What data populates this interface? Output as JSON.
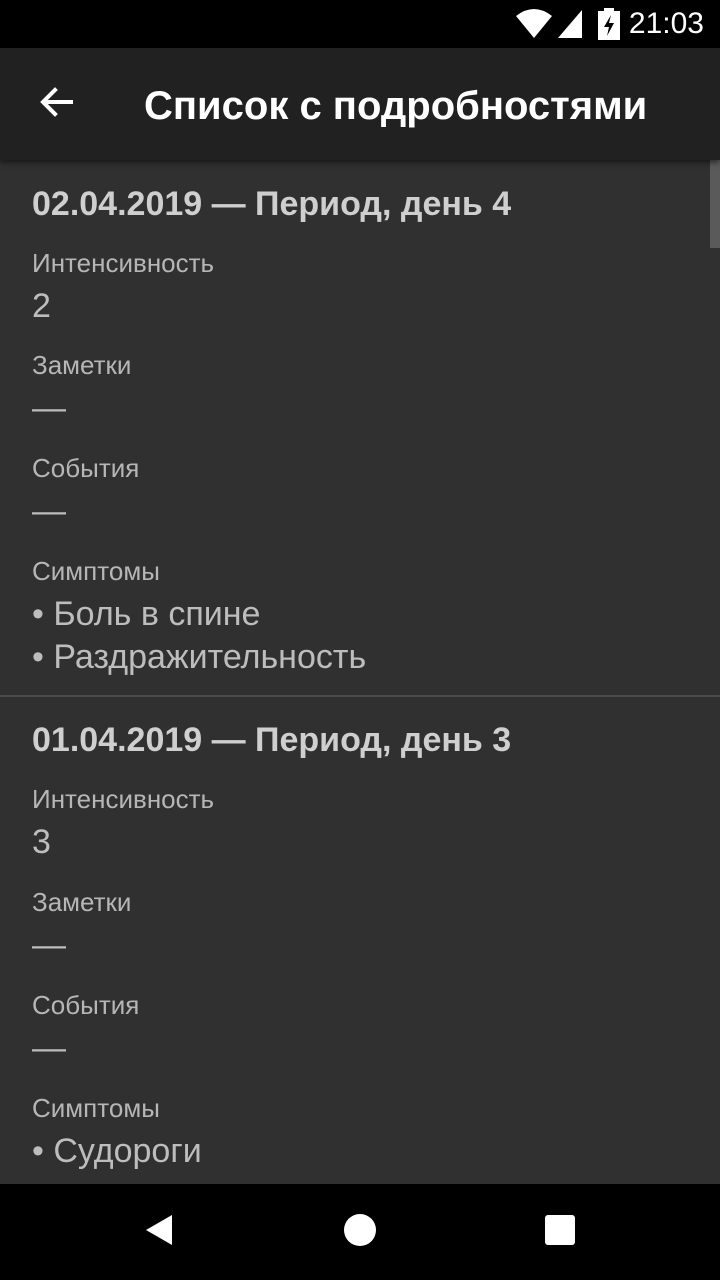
{
  "status_bar": {
    "time": "21:03",
    "icons": [
      "wifi-icon",
      "signal-icon",
      "battery-charging-icon"
    ]
  },
  "toolbar": {
    "back_icon": "arrow-left-icon",
    "title": "Список с подробностями"
  },
  "entries": [
    {
      "title": "02.04.2019 — Период, день 4",
      "intensity_label": "Интенсивность",
      "intensity_value": "2",
      "notes_label": "Заметки",
      "notes_value": "—",
      "events_label": "События",
      "events_value": "—",
      "symptoms_label": "Симптомы",
      "symptoms": [
        "• Боль в спине",
        "• Раздражительность"
      ]
    },
    {
      "title": "01.04.2019 — Период, день 3",
      "intensity_label": "Интенсивность",
      "intensity_value": "3",
      "notes_label": "Заметки",
      "notes_value": "—",
      "events_label": "События",
      "events_value": "—",
      "symptoms_label": "Симптомы",
      "symptoms": [
        "• Судороги"
      ]
    }
  ],
  "nav_bar": {
    "buttons": [
      "back-triangle-icon",
      "home-circle-icon",
      "recents-square-icon"
    ]
  }
}
